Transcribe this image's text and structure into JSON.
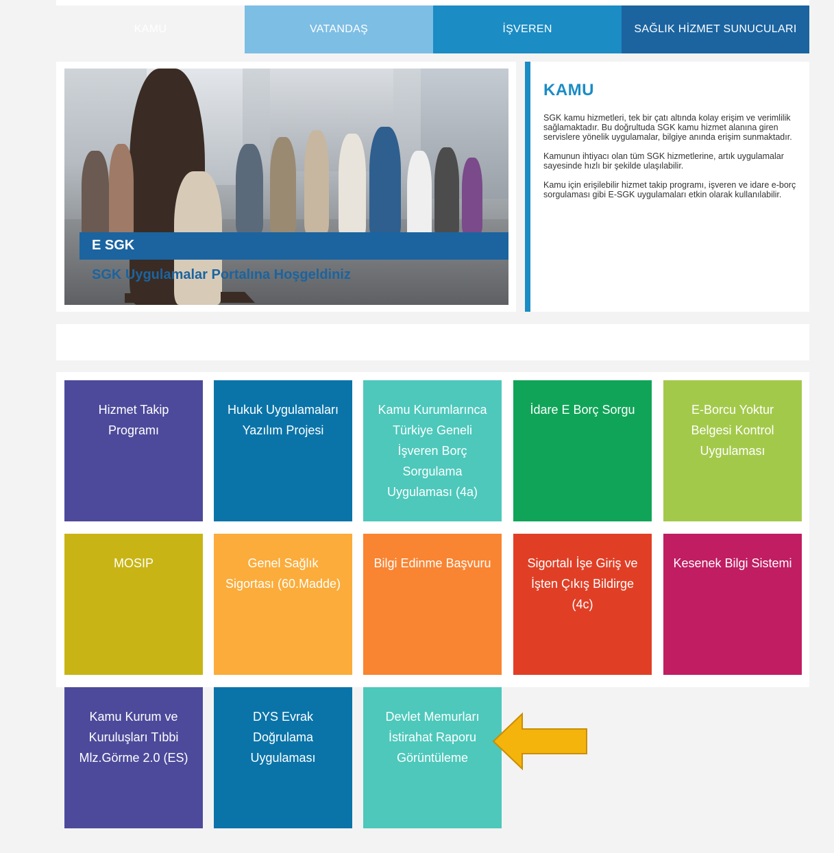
{
  "tabs": [
    {
      "label": "KAMU"
    },
    {
      "label": "VATANDAŞ"
    },
    {
      "label": "İŞVEREN"
    },
    {
      "label": "SAĞLIK HİZMET SUNUCULARI"
    }
  ],
  "hero": {
    "banner_label": "E SGK",
    "welcome": "SGK Uygulamalar Portalına Hoşgeldiniz"
  },
  "info": {
    "title": "KAMU",
    "paragraphs": [
      "SGK kamu hizmetleri, tek bir çatı altında kolay erişim ve verimlilik sağlamaktadır. Bu doğrultuda SGK kamu hizmet alanına giren servislere yönelik uygulamalar, bilgiye anında erişim sunmaktadır.",
      "Kamunun ihtiyacı olan tüm SGK hizmetlerine, artık uygulamalar sayesinde hızlı bir şekilde ulaşılabilir.",
      "Kamu için erişilebilir hizmet takip programı, işveren ve idare e-borç sorgulaması gibi E-SGK uygulamaları etkin olarak kullanılabilir."
    ]
  },
  "tiles": [
    {
      "label": "Hizmet Takip Programı",
      "color": "#4d4a9b"
    },
    {
      "label": "Hukuk Uygulamaları Yazılım Projesi",
      "color": "#0a74a9"
    },
    {
      "label": "Kamu Kurumlarınca Türkiye Geneli İşveren Borç Sorgulama Uygulaması (4a)",
      "color": "#4dc8bb"
    },
    {
      "label": "İdare E Borç Sorgu",
      "color": "#10a458"
    },
    {
      "label": "E-Borcu Yoktur Belgesi Kontrol Uygulaması",
      "color": "#a3c94b"
    },
    {
      "label": "MOSIP",
      "color": "#c8b515"
    },
    {
      "label": "Genel Sağlık Sigortası (60.Madde)",
      "color": "#fbac3a"
    },
    {
      "label": "Bilgi Edinme Başvuru",
      "color": "#f98432"
    },
    {
      "label": "Sigortalı İşe Giriş ve İşten Çıkış Bildirge (4c)",
      "color": "#e03f26"
    },
    {
      "label": "Kesenek Bilgi Sistemi",
      "color": "#c01d62"
    },
    {
      "label": "Kamu Kurum ve Kuruluşları Tıbbi Mlz.Görme 2.0 (ES)",
      "color": "#4d4a9b"
    },
    {
      "label": "DYS Evrak Doğrulama Uygulaması",
      "color": "#0a74a9"
    },
    {
      "label": "Devlet Memurları İstirahat Raporu Görüntüleme",
      "color": "#4dc8bb"
    }
  ],
  "arrow": {
    "color": "#f5b40c",
    "icon": "arrow-left-icon"
  }
}
